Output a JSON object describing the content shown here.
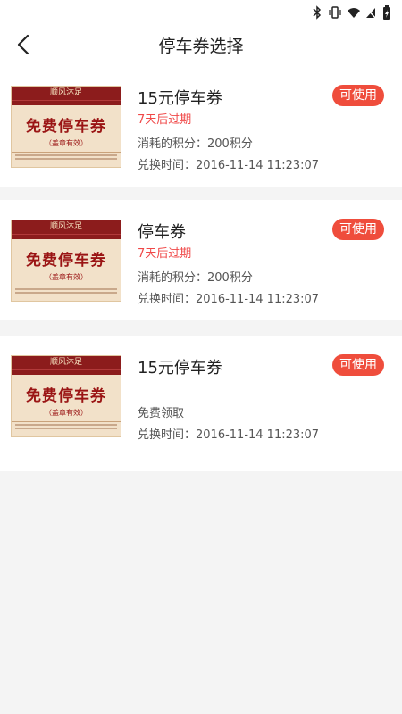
{
  "status_bar": {
    "icons": [
      "bluetooth-icon",
      "vibrate-icon",
      "wifi-icon",
      "no-sim-icon",
      "battery-icon"
    ]
  },
  "nav": {
    "title": "停车券选择",
    "back_icon": "chevron-left-icon"
  },
  "colors": {
    "accent": "#ef4d3c",
    "expire_text": "#f04848",
    "thumb_red": "#8c1c1c"
  },
  "thumbnail": {
    "brand": "顺风沐足",
    "title": "免费停车券",
    "note": "（盖章有效）"
  },
  "coupons": [
    {
      "name": "15元停车券",
      "expire": "7天后过期",
      "detail": "消耗的积分：200积分",
      "time": "兑换时间：2016-11-14 11:23:07",
      "status": "可使用"
    },
    {
      "name": "停车券",
      "expire": "7天后过期",
      "detail": "消耗的积分：200积分",
      "time": "兑换时间：2016-11-14 11:23:07",
      "status": "可使用"
    },
    {
      "name": "15元停车券",
      "expire": "",
      "detail": "免费领取",
      "time": "兑换时间：2016-11-14 11:23:07",
      "status": "可使用"
    }
  ]
}
